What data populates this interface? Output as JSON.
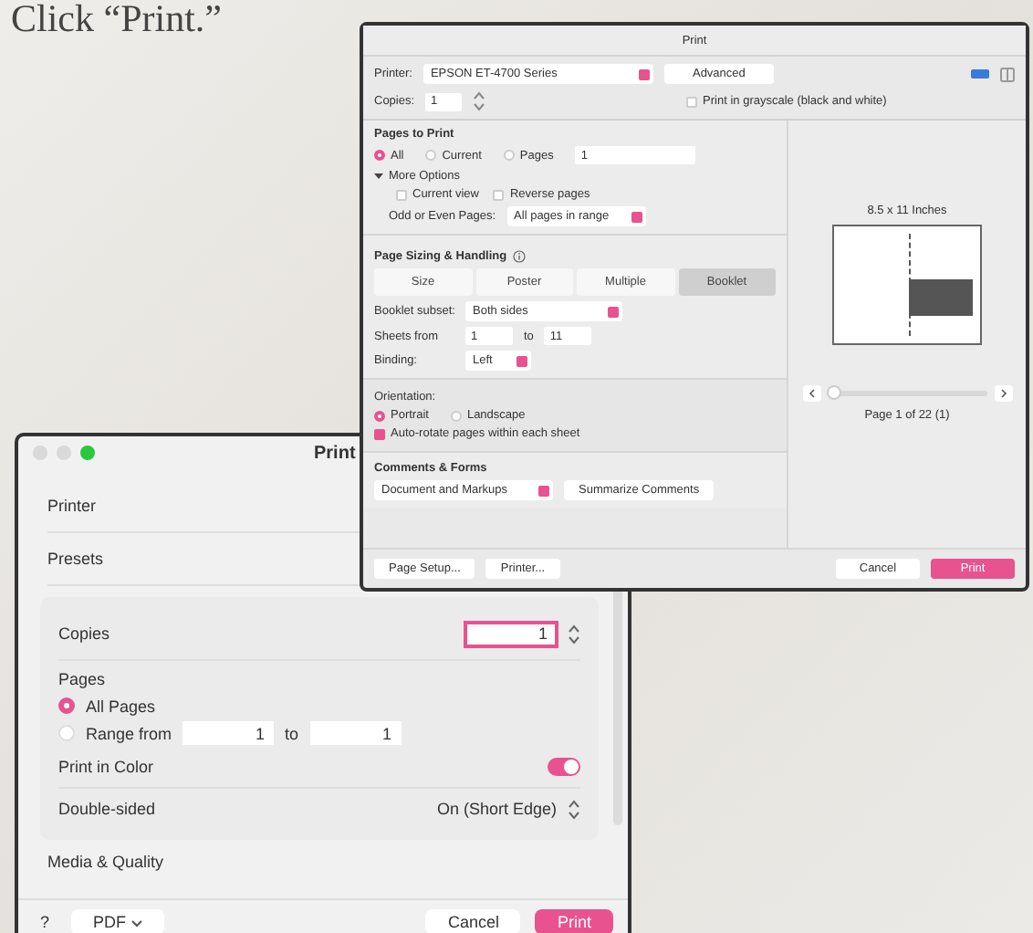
{
  "caption": "Click “Print.”",
  "print_dialog": {
    "title": "Print",
    "printer": {
      "label": "Printer:",
      "value": "EPSON ET-4700 Series"
    },
    "advanced_button": "Advanced",
    "copies": {
      "label": "Copies:",
      "value": "1"
    },
    "grayscale": {
      "label": "Print in grayscale (black and white)",
      "checked": false
    },
    "pages_to_print": {
      "heading": "Pages to Print",
      "options": [
        {
          "label": "All",
          "selected": true
        },
        {
          "label": "Current",
          "selected": false
        },
        {
          "label": "Pages",
          "selected": false
        }
      ],
      "pages_value": "1",
      "more_options": {
        "label": "More Options",
        "expanded": true
      },
      "checks": [
        {
          "label": "Current view",
          "checked": false
        },
        {
          "label": "Reverse pages",
          "checked": false
        }
      ],
      "odd_even": {
        "label": "Odd or Even Pages:",
        "value": "All pages in range"
      }
    },
    "sizing": {
      "heading": "Page Sizing & Handling",
      "modes": [
        {
          "label": "Size",
          "selected": false
        },
        {
          "label": "Poster",
          "selected": false
        },
        {
          "label": "Multiple",
          "selected": false
        },
        {
          "label": "Booklet",
          "selected": true
        }
      ],
      "booklet_subset": {
        "label": "Booklet subset:",
        "value": "Both sides"
      },
      "sheets": {
        "label": "Sheets from",
        "from": "1",
        "to_label": "to",
        "to": "11"
      },
      "binding": {
        "label": "Binding:",
        "value": "Left"
      }
    },
    "orientation": {
      "heading": "Orientation:",
      "options": [
        {
          "label": "Portrait",
          "selected": true
        },
        {
          "label": "Landscape",
          "selected": false
        }
      ],
      "auto_rotate": {
        "label": "Auto-rotate pages within each sheet",
        "checked": true
      }
    },
    "comments": {
      "heading": "Comments & Forms",
      "value": "Document and Markups",
      "summarize_button": "Summarize Comments"
    },
    "preview": {
      "paper_size": "8.5 x 11 Inches",
      "level": 0,
      "page_count": "Page 1 of 22 (1)"
    },
    "buttons": {
      "page_setup": "Page Setup...",
      "printer": "Printer...",
      "cancel": "Cancel",
      "print": "Print"
    }
  },
  "mac_dialog": {
    "title": "Print",
    "printer_label": "Printer",
    "presets_label": "Presets",
    "copies": {
      "label": "Copies",
      "value": "1"
    },
    "pages": {
      "heading": "Pages",
      "options": [
        {
          "label": "All Pages",
          "selected": true
        },
        {
          "label": "Range from",
          "selected": false
        }
      ],
      "range_from": "1",
      "range_to_label": "to",
      "range_to": "1"
    },
    "print_in_color": {
      "label": "Print in Color",
      "on": true
    },
    "double_sided": {
      "label": "Double-sided",
      "value": "On (Short Edge)"
    },
    "media_quality": "Media & Quality",
    "help_button": "?",
    "pdf_button": "PDF",
    "cancel": "Cancel",
    "print": "Print"
  }
}
